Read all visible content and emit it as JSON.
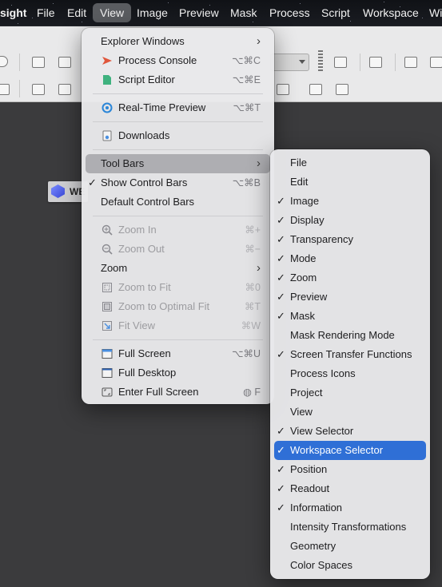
{
  "menubar": {
    "app_name": "sight",
    "items": [
      "File",
      "Edit",
      "View",
      "Image",
      "Preview",
      "Mask",
      "Process",
      "Script",
      "Workspace",
      "Wi"
    ]
  },
  "workspace_chip": {
    "label": "WE"
  },
  "view_menu": {
    "explorer_windows": "Explorer Windows",
    "process_console": {
      "label": "Process Console",
      "shortcut": "⌥⌘C"
    },
    "script_editor": {
      "label": "Script Editor",
      "shortcut": "⌥⌘E"
    },
    "realtime_preview": {
      "label": "Real-Time Preview",
      "shortcut": "⌥⌘T"
    },
    "downloads": "Downloads",
    "tool_bars": "Tool Bars",
    "show_control_bars": {
      "label": "Show Control Bars",
      "shortcut": "⌥⌘B"
    },
    "default_control_bars": "Default Control Bars",
    "zoom_in": {
      "label": "Zoom In",
      "shortcut": "⌘+"
    },
    "zoom_out": {
      "label": "Zoom Out",
      "shortcut": "⌘−"
    },
    "zoom": "Zoom",
    "zoom_to_fit": {
      "label": "Zoom to Fit",
      "shortcut": "⌘0"
    },
    "zoom_optimal": {
      "label": "Zoom to Optimal Fit",
      "shortcut": "⌘T"
    },
    "fit_view": {
      "label": "Fit View",
      "shortcut": "⌘W"
    },
    "full_screen": {
      "label": "Full Screen",
      "shortcut": "⌥⌘U"
    },
    "full_desktop": "Full Desktop",
    "enter_full_screen": {
      "label": "Enter Full Screen",
      "shortcut": "F"
    }
  },
  "toolbars_menu": {
    "items": [
      {
        "label": "File",
        "checked": false
      },
      {
        "label": "Edit",
        "checked": false
      },
      {
        "label": "Image",
        "checked": true
      },
      {
        "label": "Display",
        "checked": true
      },
      {
        "label": "Transparency",
        "checked": true
      },
      {
        "label": "Mode",
        "checked": true
      },
      {
        "label": "Zoom",
        "checked": true
      },
      {
        "label": "Preview",
        "checked": true
      },
      {
        "label": "Mask",
        "checked": true
      },
      {
        "label": "Mask Rendering Mode",
        "checked": false
      },
      {
        "label": "Screen Transfer Functions",
        "checked": true
      },
      {
        "label": "Process Icons",
        "checked": false
      },
      {
        "label": "Project",
        "checked": false
      },
      {
        "label": "View",
        "checked": false
      },
      {
        "label": "View Selector",
        "checked": true
      },
      {
        "label": "Workspace Selector",
        "checked": true,
        "selected": true
      },
      {
        "label": "Position",
        "checked": true
      },
      {
        "label": "Readout",
        "checked": true
      },
      {
        "label": "Information",
        "checked": true
      },
      {
        "label": "Intensity Transformations",
        "checked": false
      },
      {
        "label": "Geometry",
        "checked": false
      },
      {
        "label": "Color Spaces",
        "checked": false
      }
    ]
  },
  "colors": {
    "accent": "#2f6fd6",
    "hover": "#aeaeb2",
    "menu_bg": "#e8e8ea"
  }
}
